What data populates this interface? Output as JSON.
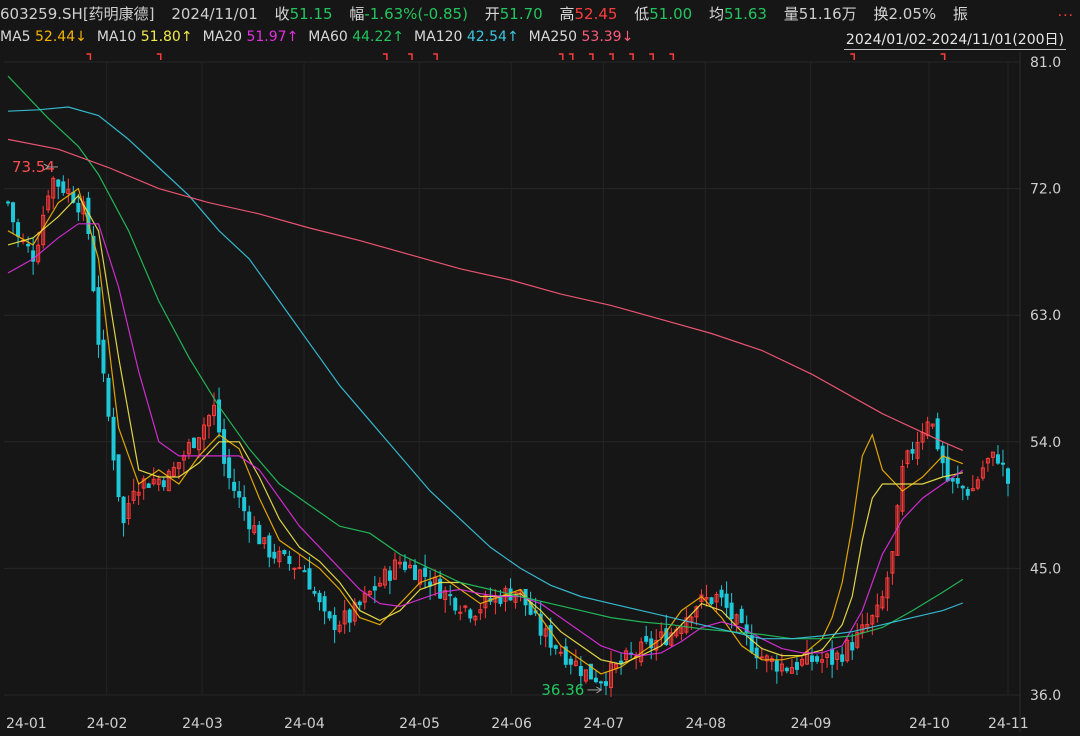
{
  "header": {
    "symbol": "603259.SH[药明康德]",
    "date": "2024/11/01",
    "close_label": "收",
    "close_value": "51.15",
    "change_label": "幅",
    "change_value": "-1.63%(-0.85)",
    "open_label": "开",
    "open_value": "51.70",
    "high_label": "高",
    "high_value": "52.45",
    "low_label": "低",
    "low_value": "51.00",
    "avg_label": "均",
    "avg_value": "51.63",
    "volume_label": "量",
    "volume_value": "51.16万",
    "turnover_label": "换",
    "turnover_value": "2.05%",
    "amplitude_label": "振",
    "more": "..."
  },
  "ma_legend": [
    {
      "label": "MA5",
      "value": "52.44↓",
      "color": "#f5b400"
    },
    {
      "label": "MA10",
      "value": "51.80↑",
      "color": "#f3e84a"
    },
    {
      "label": "MA20",
      "value": "51.97↑",
      "color": "#e030e0"
    },
    {
      "label": "MA60",
      "value": "44.22↑",
      "color": "#22c55e"
    },
    {
      "label": "MA120",
      "value": "42.54↑",
      "color": "#38c8e0"
    },
    {
      "label": "MA250",
      "value": "53.39↓",
      "color": "#ff5a7a"
    }
  ],
  "range": "2024/01/02-2024/11/01(200日)",
  "colors": {
    "up": "#ff3b3b",
    "down": "#1fc8d8",
    "grid": "#2a2a2a",
    "axis_text": "#cfcfcf",
    "annot_high": "#ff4d4d",
    "annot_low": "#22c55e"
  },
  "chart_data": {
    "type": "candlestick",
    "title": "603259.SH[药明康德]",
    "y_ticks": [
      "81.0",
      "72.0",
      "63.0",
      "54.0",
      "45.0",
      "36.0"
    ],
    "ylim": [
      36.0,
      81.0
    ],
    "x_tick_labels": [
      "24-01",
      "24-02",
      "24-03",
      "24-04",
      "24-05",
      "24-06",
      "24-07",
      "24-08",
      "24-09",
      "24-10",
      "24-11"
    ],
    "annotations": [
      {
        "text": "73.54",
        "kind": "high",
        "date": "2024-01-15"
      },
      {
        "text": "36.36",
        "kind": "low",
        "date": "2024-07-01"
      }
    ],
    "ohlc_anchors": [
      {
        "date": "2024-01-02",
        "close": 71.0
      },
      {
        "date": "2024-01-05",
        "close": 68.5
      },
      {
        "date": "2024-01-10",
        "close": 67.2
      },
      {
        "date": "2024-01-15",
        "close": 72.8
      },
      {
        "date": "2024-01-22",
        "close": 71.5
      },
      {
        "date": "2024-01-26",
        "close": 70.0
      },
      {
        "date": "2024-01-30",
        "close": 60.0
      },
      {
        "date": "2024-02-02",
        "close": 55.0
      },
      {
        "date": "2024-02-06",
        "close": 48.0
      },
      {
        "date": "2024-02-09",
        "close": 51.0
      },
      {
        "date": "2024-02-20",
        "close": 51.5
      },
      {
        "date": "2024-02-27",
        "close": 54.0
      },
      {
        "date": "2024-03-05",
        "close": 56.5
      },
      {
        "date": "2024-03-08",
        "close": 52.0
      },
      {
        "date": "2024-03-14",
        "close": 49.0
      },
      {
        "date": "2024-03-20",
        "close": 46.5
      },
      {
        "date": "2024-03-26",
        "close": 45.5
      },
      {
        "date": "2024-04-01",
        "close": 45.0
      },
      {
        "date": "2024-04-08",
        "close": 41.0
      },
      {
        "date": "2024-04-15",
        "close": 41.5
      },
      {
        "date": "2024-04-22",
        "close": 43.5
      },
      {
        "date": "2024-04-30",
        "close": 45.5
      },
      {
        "date": "2024-05-08",
        "close": 44.5
      },
      {
        "date": "2024-05-15",
        "close": 43.0
      },
      {
        "date": "2024-05-22",
        "close": 42.0
      },
      {
        "date": "2024-05-30",
        "close": 43.0
      },
      {
        "date": "2024-06-05",
        "close": 43.5
      },
      {
        "date": "2024-06-12",
        "close": 40.5
      },
      {
        "date": "2024-06-19",
        "close": 39.0
      },
      {
        "date": "2024-06-26",
        "close": 37.5
      },
      {
        "date": "2024-07-01",
        "close": 37.2
      },
      {
        "date": "2024-07-08",
        "close": 38.5
      },
      {
        "date": "2024-07-15",
        "close": 39.5
      },
      {
        "date": "2024-07-22",
        "close": 40.5
      },
      {
        "date": "2024-07-29",
        "close": 42.5
      },
      {
        "date": "2024-08-05",
        "close": 43.0
      },
      {
        "date": "2024-08-12",
        "close": 40.5
      },
      {
        "date": "2024-08-19",
        "close": 38.5
      },
      {
        "date": "2024-08-26",
        "close": 38.0
      },
      {
        "date": "2024-09-02",
        "close": 38.5
      },
      {
        "date": "2024-09-09",
        "close": 38.5
      },
      {
        "date": "2024-09-16",
        "close": 40.0
      },
      {
        "date": "2024-09-23",
        "close": 42.0
      },
      {
        "date": "2024-09-27",
        "close": 46.0
      },
      {
        "date": "2024-09-30",
        "close": 52.0
      },
      {
        "date": "2024-10-08",
        "close": 56.0
      },
      {
        "date": "2024-10-14",
        "close": 51.0
      },
      {
        "date": "2024-10-21",
        "close": 50.5
      },
      {
        "date": "2024-10-25",
        "close": 52.5
      },
      {
        "date": "2024-10-29",
        "close": 53.0
      },
      {
        "date": "2024-11-01",
        "close": 51.15
      }
    ],
    "ma_lines": [
      {
        "name": "MA5",
        "points": [
          [
            0,
            69
          ],
          [
            5,
            68
          ],
          [
            10,
            71
          ],
          [
            14,
            72
          ],
          [
            18,
            67
          ],
          [
            22,
            55
          ],
          [
            26,
            51
          ],
          [
            30,
            52
          ],
          [
            34,
            51
          ],
          [
            38,
            53
          ],
          [
            42,
            54.5
          ],
          [
            46,
            53.5
          ],
          [
            50,
            50
          ],
          [
            54,
            47
          ],
          [
            58,
            46
          ],
          [
            62,
            45
          ],
          [
            66,
            43.5
          ],
          [
            70,
            41.5
          ],
          [
            74,
            41
          ],
          [
            78,
            42.5
          ],
          [
            82,
            44
          ],
          [
            86,
            44.5
          ],
          [
            90,
            43.5
          ],
          [
            94,
            42.5
          ],
          [
            98,
            43
          ],
          [
            102,
            43.5
          ],
          [
            106,
            41.5
          ],
          [
            110,
            39.5
          ],
          [
            114,
            38.5
          ],
          [
            118,
            37.5
          ],
          [
            122,
            38
          ],
          [
            126,
            39
          ],
          [
            130,
            40
          ],
          [
            134,
            42
          ],
          [
            138,
            43
          ],
          [
            142,
            41.5
          ],
          [
            146,
            39.5
          ],
          [
            150,
            38.5
          ],
          [
            154,
            38.5
          ],
          [
            158,
            38.8
          ],
          [
            162,
            40
          ],
          [
            164,
            41.5
          ],
          [
            166,
            44
          ],
          [
            168,
            48
          ],
          [
            170,
            53
          ],
          [
            172,
            54.5
          ],
          [
            174,
            52
          ],
          [
            178,
            50.5
          ],
          [
            182,
            51.5
          ],
          [
            186,
            53
          ],
          [
            190,
            52.44
          ]
        ]
      },
      {
        "name": "MA10",
        "points": [
          [
            0,
            68
          ],
          [
            5,
            68.5
          ],
          [
            10,
            70
          ],
          [
            14,
            71.5
          ],
          [
            18,
            69
          ],
          [
            22,
            60
          ],
          [
            26,
            52
          ],
          [
            30,
            51.5
          ],
          [
            34,
            51.5
          ],
          [
            38,
            52.5
          ],
          [
            42,
            54
          ],
          [
            46,
            54
          ],
          [
            50,
            51.5
          ],
          [
            54,
            48.5
          ],
          [
            58,
            46.5
          ],
          [
            62,
            45.5
          ],
          [
            66,
            44
          ],
          [
            70,
            42
          ],
          [
            74,
            41.3
          ],
          [
            78,
            42
          ],
          [
            82,
            43.5
          ],
          [
            86,
            44
          ],
          [
            90,
            44
          ],
          [
            94,
            43
          ],
          [
            98,
            43
          ],
          [
            102,
            43.2
          ],
          [
            106,
            42
          ],
          [
            110,
            40.5
          ],
          [
            114,
            39.5
          ],
          [
            118,
            38.5
          ],
          [
            122,
            38.2
          ],
          [
            126,
            38.8
          ],
          [
            130,
            39.5
          ],
          [
            134,
            41
          ],
          [
            138,
            42.5
          ],
          [
            142,
            42
          ],
          [
            146,
            40.5
          ],
          [
            150,
            39.3
          ],
          [
            154,
            38.8
          ],
          [
            158,
            38.8
          ],
          [
            162,
            39.2
          ],
          [
            166,
            41
          ],
          [
            168,
            43
          ],
          [
            170,
            47
          ],
          [
            172,
            50
          ],
          [
            174,
            51
          ],
          [
            178,
            51
          ],
          [
            182,
            51
          ],
          [
            186,
            51.5
          ],
          [
            190,
            51.8
          ]
        ]
      },
      {
        "name": "MA20",
        "points": [
          [
            0,
            66
          ],
          [
            5,
            67
          ],
          [
            10,
            68.5
          ],
          [
            14,
            69.5
          ],
          [
            18,
            69.5
          ],
          [
            22,
            65
          ],
          [
            26,
            59
          ],
          [
            30,
            54
          ],
          [
            34,
            53
          ],
          [
            38,
            53
          ],
          [
            42,
            53
          ],
          [
            46,
            53
          ],
          [
            50,
            52
          ],
          [
            54,
            50
          ],
          [
            58,
            48
          ],
          [
            62,
            46.5
          ],
          [
            66,
            45
          ],
          [
            70,
            43.5
          ],
          [
            74,
            42.5
          ],
          [
            78,
            42.3
          ],
          [
            82,
            42.8
          ],
          [
            86,
            43.3
          ],
          [
            90,
            43.5
          ],
          [
            94,
            43.2
          ],
          [
            98,
            43
          ],
          [
            102,
            43
          ],
          [
            106,
            42.5
          ],
          [
            110,
            41.5
          ],
          [
            114,
            40.5
          ],
          [
            118,
            39.5
          ],
          [
            122,
            39
          ],
          [
            126,
            38.8
          ],
          [
            130,
            39
          ],
          [
            134,
            39.8
          ],
          [
            138,
            40.8
          ],
          [
            142,
            41.2
          ],
          [
            146,
            40.8
          ],
          [
            150,
            40
          ],
          [
            154,
            39.3
          ],
          [
            158,
            39
          ],
          [
            162,
            39
          ],
          [
            166,
            39.5
          ],
          [
            170,
            42
          ],
          [
            174,
            46
          ],
          [
            178,
            48.5
          ],
          [
            182,
            50
          ],
          [
            186,
            51
          ],
          [
            190,
            51.97
          ]
        ]
      },
      {
        "name": "MA60",
        "points": [
          [
            0,
            80
          ],
          [
            8,
            77
          ],
          [
            14,
            75
          ],
          [
            18,
            73
          ],
          [
            24,
            69
          ],
          [
            30,
            64
          ],
          [
            36,
            60
          ],
          [
            42,
            56.5
          ],
          [
            48,
            53.5
          ],
          [
            54,
            51
          ],
          [
            60,
            49.5
          ],
          [
            66,
            48
          ],
          [
            72,
            47.5
          ],
          [
            78,
            46
          ],
          [
            84,
            45
          ],
          [
            90,
            44
          ],
          [
            96,
            43.5
          ],
          [
            102,
            43
          ],
          [
            108,
            42.5
          ],
          [
            114,
            42
          ],
          [
            120,
            41.5
          ],
          [
            126,
            41.2
          ],
          [
            132,
            41
          ],
          [
            138,
            40.7
          ],
          [
            144,
            40.5
          ],
          [
            150,
            40.3
          ],
          [
            156,
            40
          ],
          [
            162,
            40
          ],
          [
            168,
            40.2
          ],
          [
            174,
            40.8
          ],
          [
            180,
            42
          ],
          [
            186,
            43.3
          ],
          [
            190,
            44.22
          ]
        ]
      },
      {
        "name": "MA120",
        "points": [
          [
            0,
            77.5
          ],
          [
            6,
            77.6
          ],
          [
            12,
            77.8
          ],
          [
            18,
            77.2
          ],
          [
            24,
            75.5
          ],
          [
            30,
            73.5
          ],
          [
            36,
            71.5
          ],
          [
            42,
            69
          ],
          [
            48,
            67
          ],
          [
            54,
            64
          ],
          [
            60,
            61
          ],
          [
            66,
            58
          ],
          [
            72,
            55.5
          ],
          [
            78,
            53
          ],
          [
            84,
            50.5
          ],
          [
            90,
            48.5
          ],
          [
            96,
            46.5
          ],
          [
            102,
            45
          ],
          [
            108,
            43.8
          ],
          [
            114,
            43
          ],
          [
            120,
            42.5
          ],
          [
            126,
            42
          ],
          [
            132,
            41.5
          ],
          [
            138,
            41
          ],
          [
            144,
            40.5
          ],
          [
            150,
            40
          ],
          [
            156,
            40
          ],
          [
            162,
            40.2
          ],
          [
            168,
            40.5
          ],
          [
            174,
            41
          ],
          [
            180,
            41.5
          ],
          [
            186,
            42
          ],
          [
            190,
            42.54
          ]
        ]
      },
      {
        "name": "MA250",
        "points": [
          [
            0,
            75.5
          ],
          [
            10,
            74.8
          ],
          [
            20,
            73.5
          ],
          [
            30,
            72
          ],
          [
            40,
            71
          ],
          [
            50,
            70.2
          ],
          [
            60,
            69.2
          ],
          [
            70,
            68.3
          ],
          [
            80,
            67.3
          ],
          [
            90,
            66.3
          ],
          [
            100,
            65.5
          ],
          [
            110,
            64.5
          ],
          [
            120,
            63.7
          ],
          [
            130,
            62.7
          ],
          [
            140,
            61.7
          ],
          [
            150,
            60.5
          ],
          [
            160,
            58.8
          ],
          [
            168,
            57.2
          ],
          [
            174,
            56
          ],
          [
            180,
            55
          ],
          [
            186,
            54
          ],
          [
            190,
            53.39
          ]
        ]
      }
    ]
  }
}
